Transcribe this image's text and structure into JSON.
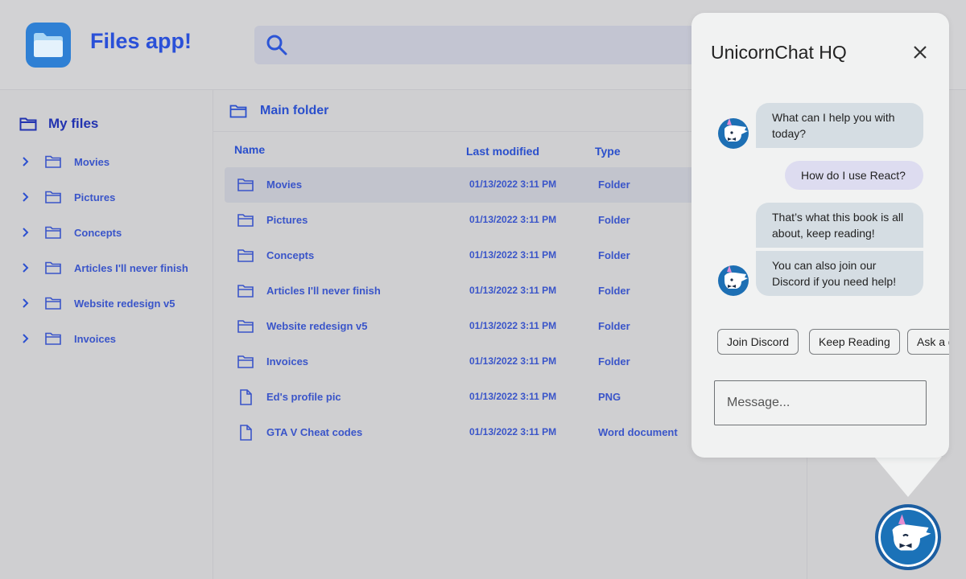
{
  "header": {
    "app_title": "Files app!",
    "search_placeholder": ""
  },
  "sidebar": {
    "root_label": "My files",
    "items": [
      {
        "label": "Movies"
      },
      {
        "label": "Pictures"
      },
      {
        "label": "Concepts"
      },
      {
        "label": "Articles I'll never finish"
      },
      {
        "label": "Website redesign v5"
      },
      {
        "label": "Invoices"
      }
    ]
  },
  "main": {
    "breadcrumb": "Main folder",
    "columns": {
      "name": "Name",
      "modified": "Last modified",
      "type": "Type"
    },
    "rows": [
      {
        "name": "Movies",
        "modified": "01/13/2022 3:11 PM",
        "type": "Folder",
        "icon": "folder-icon",
        "selected": true
      },
      {
        "name": "Pictures",
        "modified": "01/13/2022 3:11 PM",
        "type": "Folder",
        "icon": "folder-icon"
      },
      {
        "name": "Concepts",
        "modified": "01/13/2022 3:11 PM",
        "type": "Folder",
        "icon": "folder-icon"
      },
      {
        "name": "Articles I'll never finish",
        "modified": "01/13/2022 3:11 PM",
        "type": "Folder",
        "icon": "folder-icon"
      },
      {
        "name": "Website redesign v5",
        "modified": "01/13/2022 3:11 PM",
        "type": "Folder",
        "icon": "folder-icon"
      },
      {
        "name": "Invoices",
        "modified": "01/13/2022 3:11 PM",
        "type": "Folder",
        "icon": "folder-icon"
      },
      {
        "name": "Ed's profile pic",
        "modified": "01/13/2022 3:11 PM",
        "type": "PNG",
        "icon": "file-icon"
      },
      {
        "name": "GTA V Cheat codes",
        "modified": "01/13/2022 3:11 PM",
        "type": "Word document",
        "icon": "file-icon"
      }
    ]
  },
  "chat": {
    "title": "UnicornChat HQ",
    "messages": [
      {
        "from": "bot",
        "text": "What can I help you with today?"
      },
      {
        "from": "user",
        "text": "How do I use React?"
      },
      {
        "from": "bot",
        "text": "That’s what this book is all about, keep reading!"
      },
      {
        "from": "bot",
        "text": "You can also join our Discord if you need help!"
      }
    ],
    "quick_replies": [
      "Join Discord",
      "Keep Reading",
      "Ask a question"
    ],
    "input_placeholder": "Message..."
  },
  "colors": {
    "accent": "#2a50d8",
    "chat_bot_bubble": "#d5dde3",
    "chat_user_bubble": "#dddcf0",
    "launcher": "#1b72b8"
  }
}
